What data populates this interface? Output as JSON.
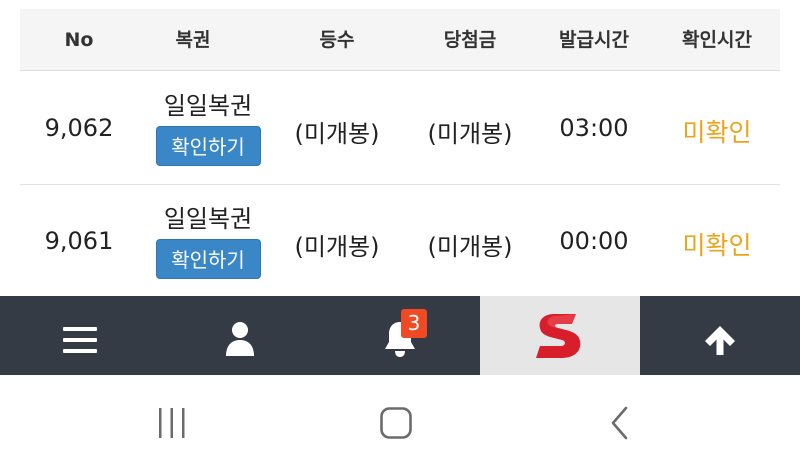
{
  "table": {
    "headers": {
      "no": "No",
      "game": "복권",
      "rank": "등수",
      "prize": "당첨금",
      "issue_time": "발급시간",
      "check_time": "확인시간"
    },
    "rows": [
      {
        "no": "9,062",
        "game": "일일복권",
        "button": "확인하기",
        "rank": "(미개봉)",
        "prize": "(미개봉)",
        "issue_time": "03:00",
        "check_time": "미확인"
      },
      {
        "no": "9,061",
        "game": "일일복권",
        "button": "확인하기",
        "rank": "(미개봉)",
        "prize": "(미개봉)",
        "issue_time": "00:00",
        "check_time": "미확인"
      }
    ]
  },
  "bottom_nav": {
    "items": [
      {
        "icon": "menu-icon"
      },
      {
        "icon": "user-icon"
      },
      {
        "icon": "bell-icon",
        "badge": "3"
      },
      {
        "icon": "brand-logo-s-icon",
        "active": true
      },
      {
        "icon": "arrow-up-icon"
      }
    ]
  },
  "system_nav": {
    "items": [
      {
        "icon": "recent-apps-icon"
      },
      {
        "icon": "home-icon"
      },
      {
        "icon": "back-icon"
      }
    ]
  },
  "colors": {
    "button_blue": "#3a87c8",
    "status_orange": "#eaa51c",
    "nav_dark": "#343b44",
    "badge_red": "#ef4a23"
  }
}
